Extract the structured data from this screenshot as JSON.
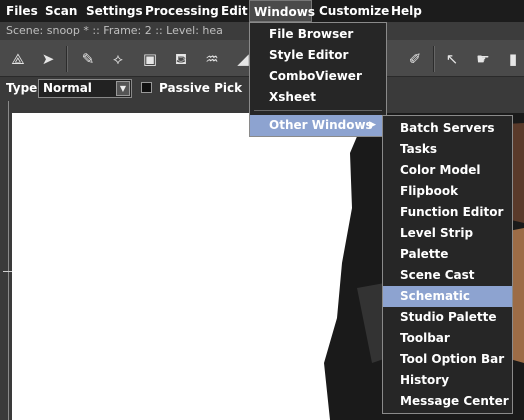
{
  "menubar": {
    "items": [
      "Files",
      "Scan",
      "Settings",
      "Processing",
      "Edit",
      "Windows",
      "Customize",
      "Help"
    ],
    "active": "Windows"
  },
  "infobar": {
    "text": "Scene: snoop *  ::  Frame: 2  ::  Level: hea"
  },
  "tools": [
    "animate-tool-icon",
    "selection-tool-icon",
    "brush-tool-icon",
    "geometric-tool-icon",
    "type-tool-icon",
    "fill-tool-icon",
    "paint-brush-tool-icon",
    "eraser-tool-icon",
    "style-picker-icon",
    "rgb-picker-icon",
    "control-point-editor-icon",
    "pinch-tool-icon"
  ],
  "tool_options": {
    "type_label": "Type:",
    "type_value": "Normal",
    "passive_pick_label": "Passive Pick",
    "passive_pick_checked": false
  },
  "windows_menu": {
    "items": [
      "File Browser",
      "Style Editor",
      "ComboViewer",
      "Xsheet",
      "Other Windows"
    ],
    "highlighted": "Other Windows"
  },
  "other_windows_submenu": {
    "items": [
      "Batch Servers",
      "Tasks",
      "Color Model",
      "Flipbook",
      "Function Editor",
      "Level Strip",
      "Palette",
      "Scene Cast",
      "Schematic",
      "Studio Palette",
      "Toolbar",
      "Tool Option Bar",
      "History",
      "Message Center"
    ],
    "highlighted": "Schematic"
  },
  "colors": {
    "menu_highlight": "#8da3d0",
    "menubar_bg": "#1c1c1c",
    "panel_bg": "#4a4a4a",
    "canvas_bg": "#ffffff"
  }
}
